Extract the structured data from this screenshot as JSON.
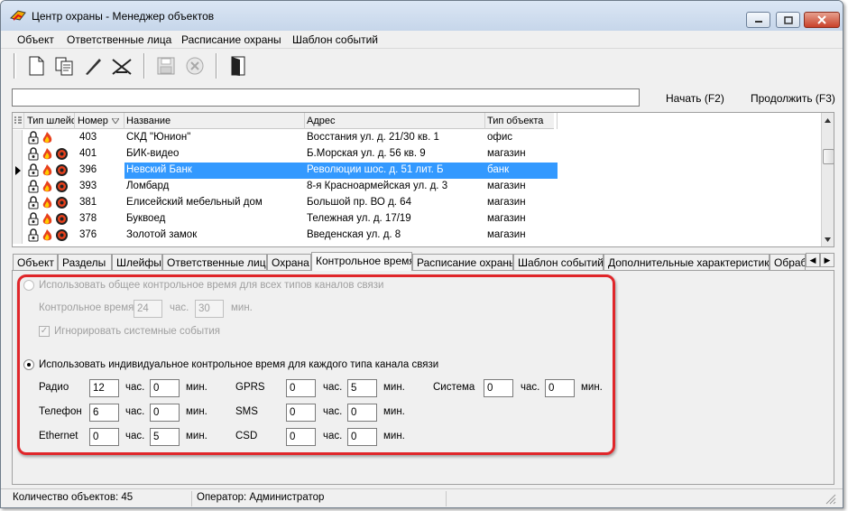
{
  "window": {
    "title": "Центр охраны - Менеджер объектов"
  },
  "menu": [
    "Объект",
    "Ответственные лица",
    "Расписание охраны",
    "Шаблон событий"
  ],
  "toolbar": {
    "icons": [
      "new-document-icon",
      "copy-icon",
      "edit-pencil-icon",
      "delete-icon",
      "save-icon",
      "cancel-icon",
      "exit-door-icon"
    ]
  },
  "search": {
    "value": "",
    "start_label": "Начать (F2)",
    "continue_label": "Продолжить (F3)"
  },
  "grid": {
    "columns": [
      "Тип шлейфов",
      "Номер",
      "Название",
      "Адрес",
      "Тип объекта"
    ],
    "rows": [
      {
        "number": "403",
        "name": "СКД \"Юнион\"",
        "address": "Восстания ул. д. 21/30 кв. 1",
        "type": "офис",
        "icons": [
          "lock",
          "fire"
        ]
      },
      {
        "number": "401",
        "name": "БИК-видео",
        "address": "Б.Морская ул. д. 56 кв. 9",
        "type": "магазин",
        "icons": [
          "lock",
          "fire",
          "target"
        ]
      },
      {
        "number": "396",
        "name": "Невский Банк",
        "address": "Революции шос. д. 51 лит. Б",
        "type": "банк",
        "icons": [
          "lock",
          "fire",
          "target"
        ],
        "selected": true
      },
      {
        "number": "393",
        "name": "Ломбард",
        "address": "8-я Красноармейская ул. д. 3",
        "type": "магазин",
        "icons": [
          "lock",
          "fire",
          "target"
        ]
      },
      {
        "number": "381",
        "name": "Елисейский мебельный дом",
        "address": "Большой пр. ВО д. 64",
        "type": "магазин",
        "icons": [
          "lock",
          "fire",
          "target"
        ]
      },
      {
        "number": "378",
        "name": "Буквоед",
        "address": "Тележная ул. д. 17/19",
        "type": "магазин",
        "icons": [
          "lock",
          "fire",
          "target"
        ]
      },
      {
        "number": "376",
        "name": "Золотой замок",
        "address": "Введенская ул. д. 8",
        "type": "магазин",
        "icons": [
          "lock",
          "fire",
          "target"
        ]
      }
    ]
  },
  "tabs": [
    "Объект",
    "Разделы",
    "Шлейфы",
    "Ответственные лица",
    "Охрана",
    "Контрольное время",
    "Расписание охраны",
    "Шаблон событий",
    "Дополнительные характеристики",
    "Обрабо"
  ],
  "active_tab": "Контрольное время",
  "control_time": {
    "common_option_label": "Использовать общее контрольное время для всех типов каналов связи",
    "common_time_label": "Контрольное время",
    "common_hours": "24",
    "hours_unit": "час.",
    "common_minutes": "30",
    "minutes_unit": "мин.",
    "ignore_system_label": "Игнорировать системные события",
    "individual_option_label": "Использовать индивидуальное контрольное время для каждого типа канала связи",
    "channels": [
      {
        "name": "Радио",
        "hours": "12",
        "minutes": "0"
      },
      {
        "name": "Телефон",
        "hours": "6",
        "minutes": "0"
      },
      {
        "name": "Ethernet",
        "hours": "0",
        "minutes": "5"
      },
      {
        "name": "GPRS",
        "hours": "0",
        "minutes": "5"
      },
      {
        "name": "SMS",
        "hours": "0",
        "minutes": "0"
      },
      {
        "name": "CSD",
        "hours": "0",
        "minutes": "0"
      },
      {
        "name": "Система",
        "hours": "0",
        "minutes": "0"
      }
    ]
  },
  "status": {
    "count_label": "Количество объектов: 45",
    "operator_label": "Оператор: Администратор"
  },
  "colors": {
    "selection": "#3399ff",
    "highlight_frame": "#e0262a"
  }
}
